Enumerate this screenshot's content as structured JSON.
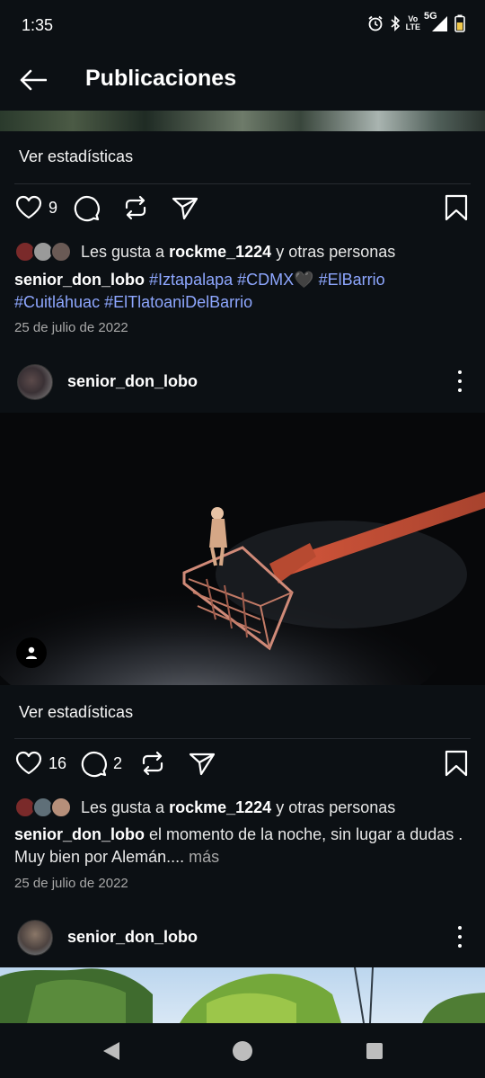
{
  "status_bar": {
    "time": "1:35",
    "network": "5G",
    "volte_top": "Vo",
    "volte_bottom": "LTE"
  },
  "header": {
    "title": "Publicaciones"
  },
  "posts": [
    {
      "stats_label": "Ver estadísticas",
      "likes_count": "9",
      "comments_count": "",
      "liked_by_prefix": "Les gusta a",
      "liked_by_user": "rockme_1224",
      "liked_by_suffix": "y otras personas",
      "caption_user": "senior_don_lobo",
      "caption_tags_line1": [
        "#Iztapalapa",
        "#CDMX🖤",
        "#ElBarrio"
      ],
      "caption_tags_line2": [
        "#Cuitláhuac",
        "#ElTlatoaniDelBarrio"
      ],
      "date": "25 de julio de 2022"
    },
    {
      "username": "senior_don_lobo",
      "stats_label": "Ver estadísticas",
      "likes_count": "16",
      "comments_count": "2",
      "liked_by_prefix": "Les gusta a",
      "liked_by_user": "rockme_1224",
      "liked_by_suffix": "y otras personas",
      "caption_user": "senior_don_lobo",
      "caption_text": "el momento de la noche, sin lugar a dudas . Muy bien por Alemán....",
      "more_label": "más",
      "date": "25 de julio de 2022"
    },
    {
      "username": "senior_don_lobo"
    }
  ],
  "colors": {
    "background": "#0c1014",
    "hashtag": "#8ea7ff",
    "muted": "#a8a8a8"
  }
}
